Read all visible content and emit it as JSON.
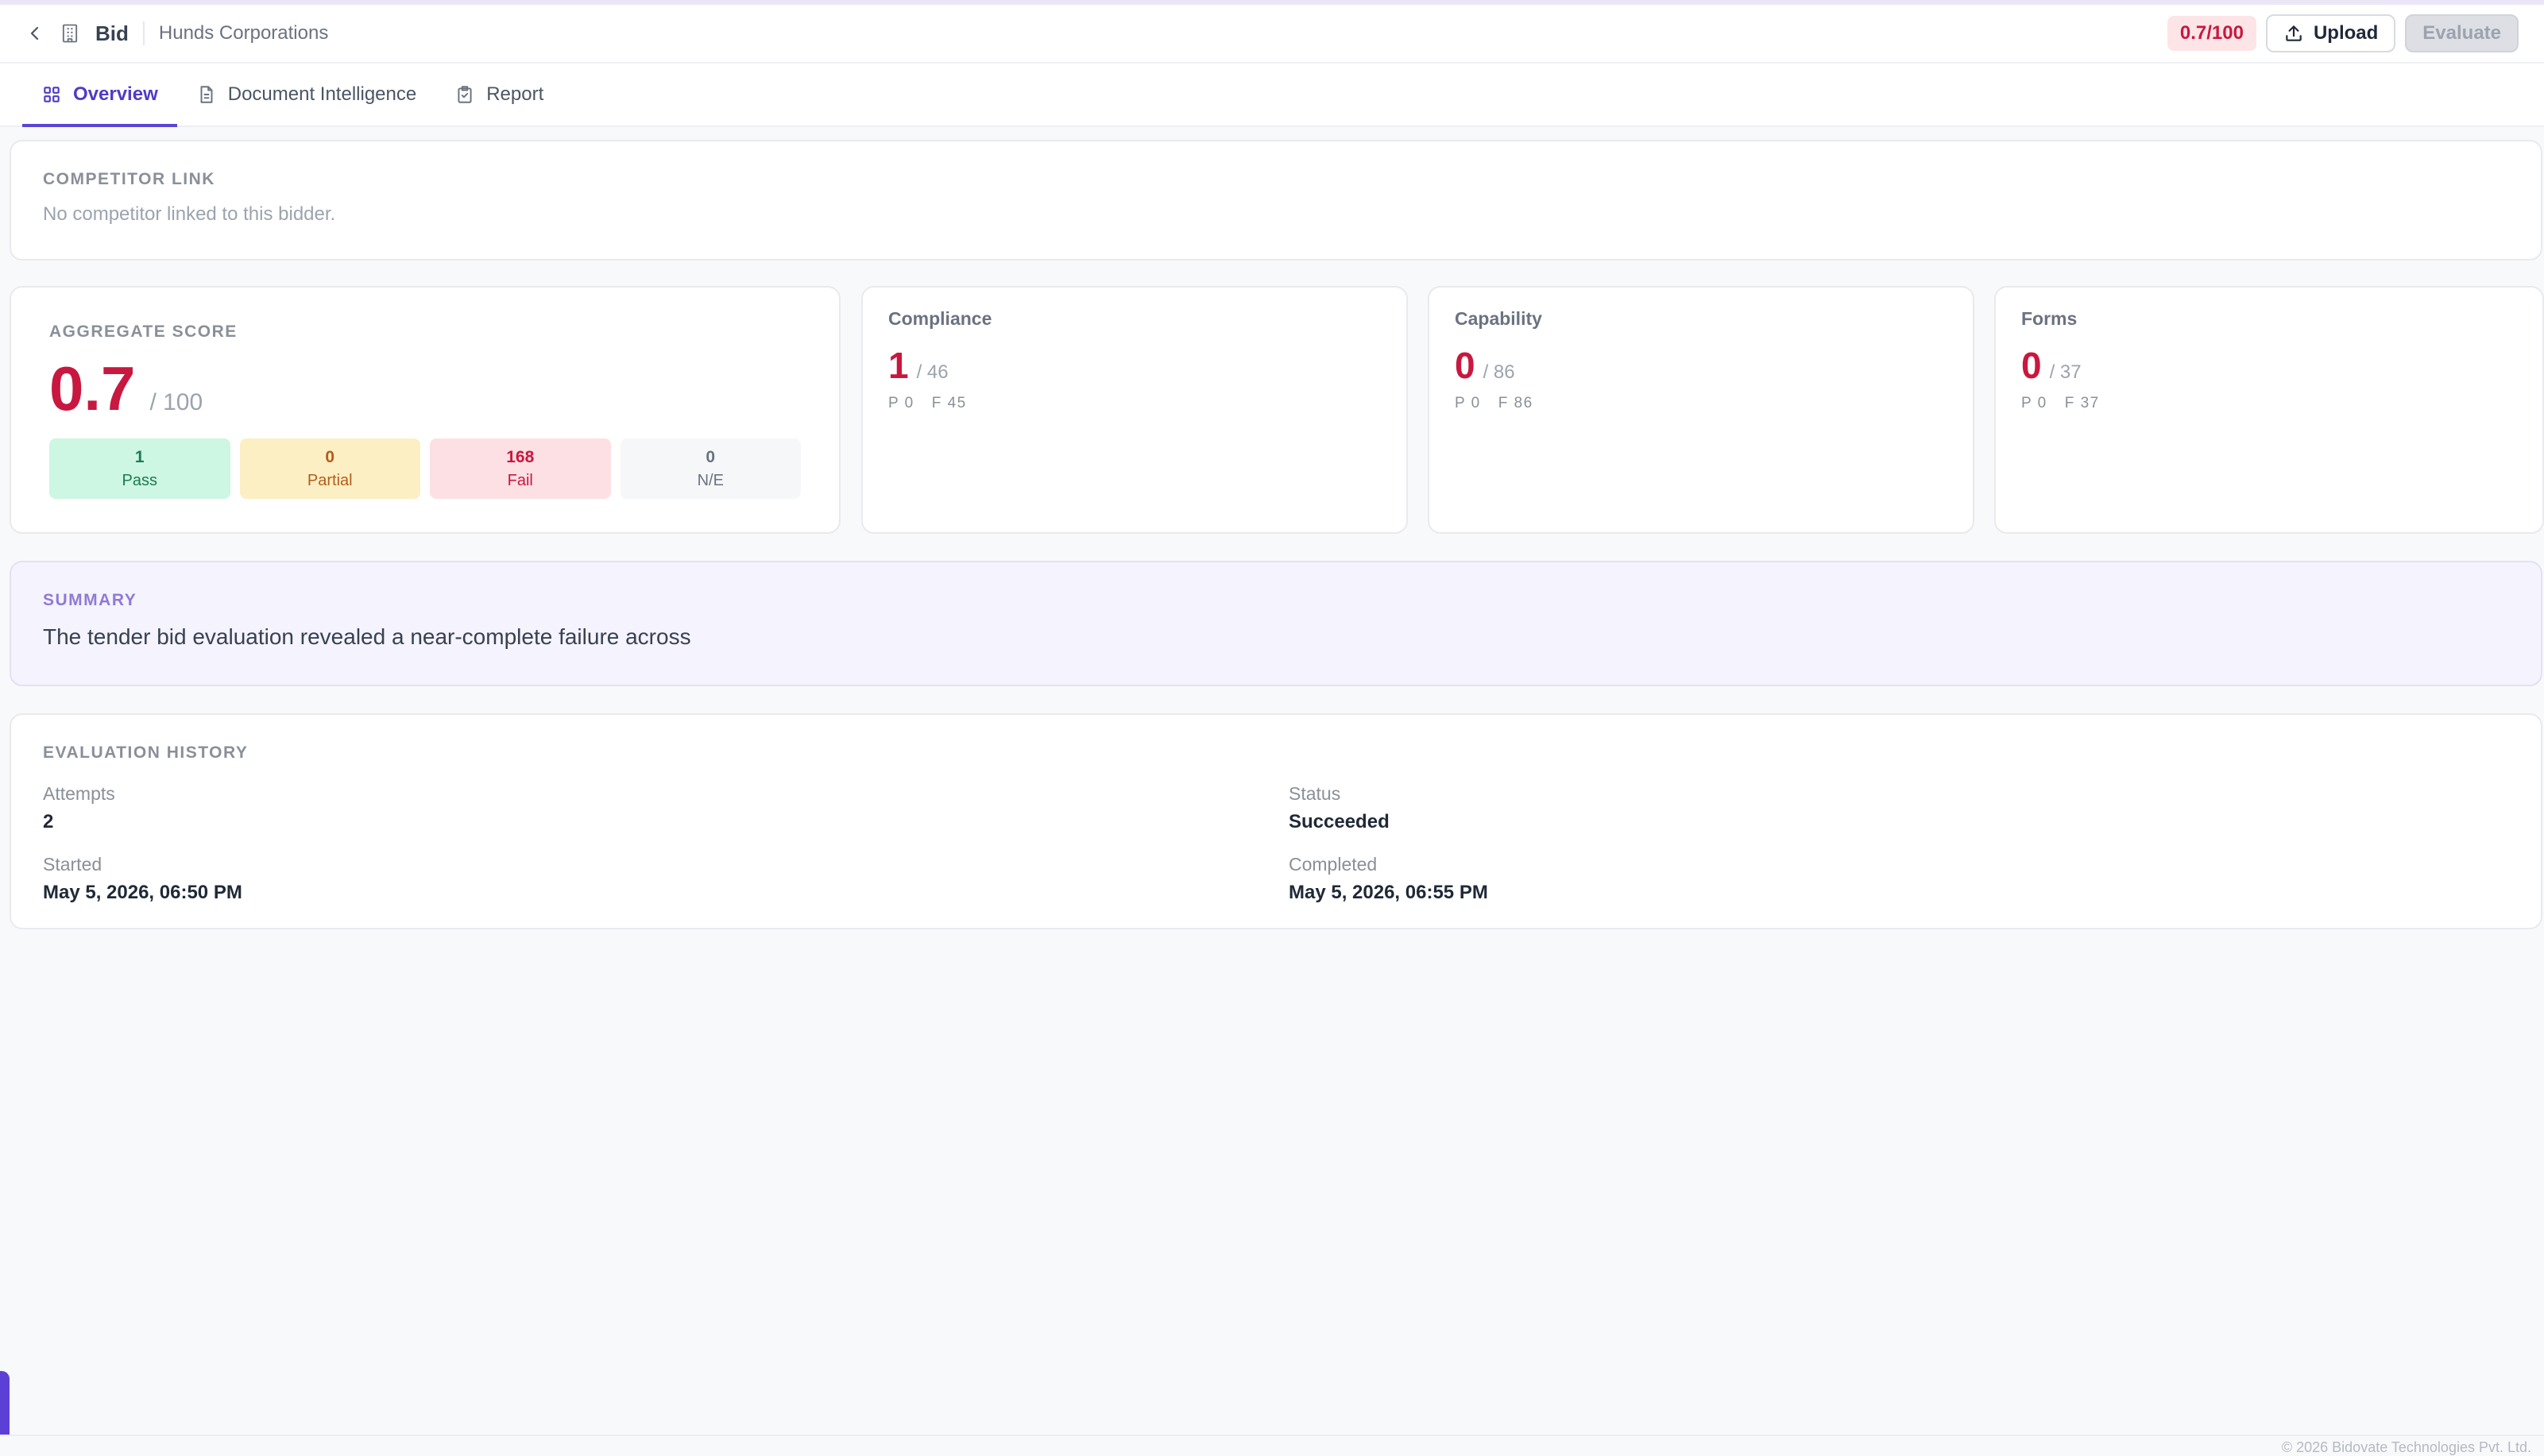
{
  "header": {
    "title": "Bid",
    "org": "Hunds Corporations",
    "score_badge": "0.7/100",
    "upload_label": "Upload",
    "evaluate_label": "Evaluate"
  },
  "tabs": [
    {
      "label": "Overview",
      "icon": "grid-icon",
      "active": true
    },
    {
      "label": "Document Intelligence",
      "icon": "document-icon",
      "active": false
    },
    {
      "label": "Report",
      "icon": "clipboard-icon",
      "active": false
    }
  ],
  "competitor": {
    "title": "COMPETITOR LINK",
    "text": "No competitor linked to this bidder."
  },
  "aggregate": {
    "title": "AGGREGATE SCORE",
    "value": "0.7",
    "total": "/ 100",
    "pass": {
      "count": "1",
      "label": "Pass"
    },
    "partial": {
      "count": "0",
      "label": "Partial"
    },
    "fail": {
      "count": "168",
      "label": "Fail"
    },
    "ne": {
      "count": "0",
      "label": "N/E"
    }
  },
  "metrics": [
    {
      "title": "Compliance",
      "value": "1",
      "total": "/ 46",
      "p": "P 0",
      "f": "F 45"
    },
    {
      "title": "Capability",
      "value": "0",
      "total": "/ 86",
      "p": "P 0",
      "f": "F 86"
    },
    {
      "title": "Forms",
      "value": "0",
      "total": "/ 37",
      "p": "P 0",
      "f": "F 37"
    }
  ],
  "summary": {
    "title": "SUMMARY",
    "text": "The tender bid evaluation revealed a near-complete failure across"
  },
  "history": {
    "title": "EVALUATION HISTORY",
    "attempts_label": "Attempts",
    "attempts": "2",
    "status_label": "Status",
    "status": "Succeeded",
    "started_label": "Started",
    "started": "May 5, 2026, 06:50 PM",
    "completed_label": "Completed",
    "completed": "May 5, 2026, 06:55 PM"
  },
  "footer": {
    "text": "© 2026 Bidovate Technologies Pvt. Ltd."
  },
  "colors": {
    "accent": "#5b45d6",
    "danger": "#c8183f",
    "pass": "#1e7a50",
    "partial": "#b45c1c"
  }
}
